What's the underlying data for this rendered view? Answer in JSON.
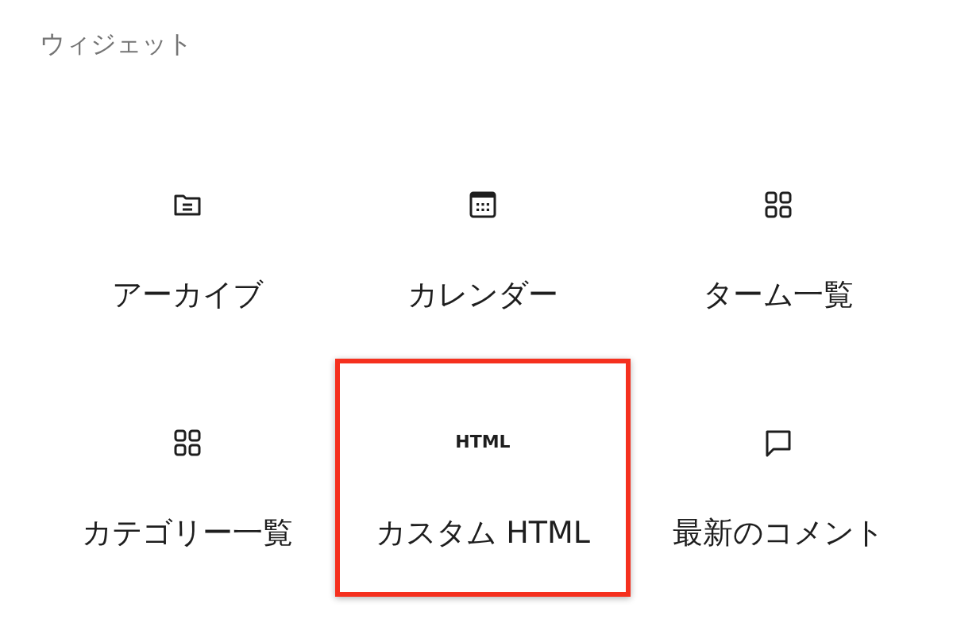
{
  "section_title": "ウィジェット",
  "widgets": [
    {
      "kind": "folder",
      "label": "アーカイブ",
      "selected": false
    },
    {
      "kind": "calendar",
      "label": "カレンダー",
      "selected": false
    },
    {
      "kind": "grid",
      "label": "ターム一覧",
      "selected": false
    },
    {
      "kind": "grid",
      "label": "カテゴリー一覧",
      "selected": false
    },
    {
      "kind": "text",
      "icon_text": "HTML",
      "label": "カスタム HTML",
      "selected": true
    },
    {
      "kind": "comment",
      "label": "最新のコメント",
      "selected": false
    }
  ]
}
